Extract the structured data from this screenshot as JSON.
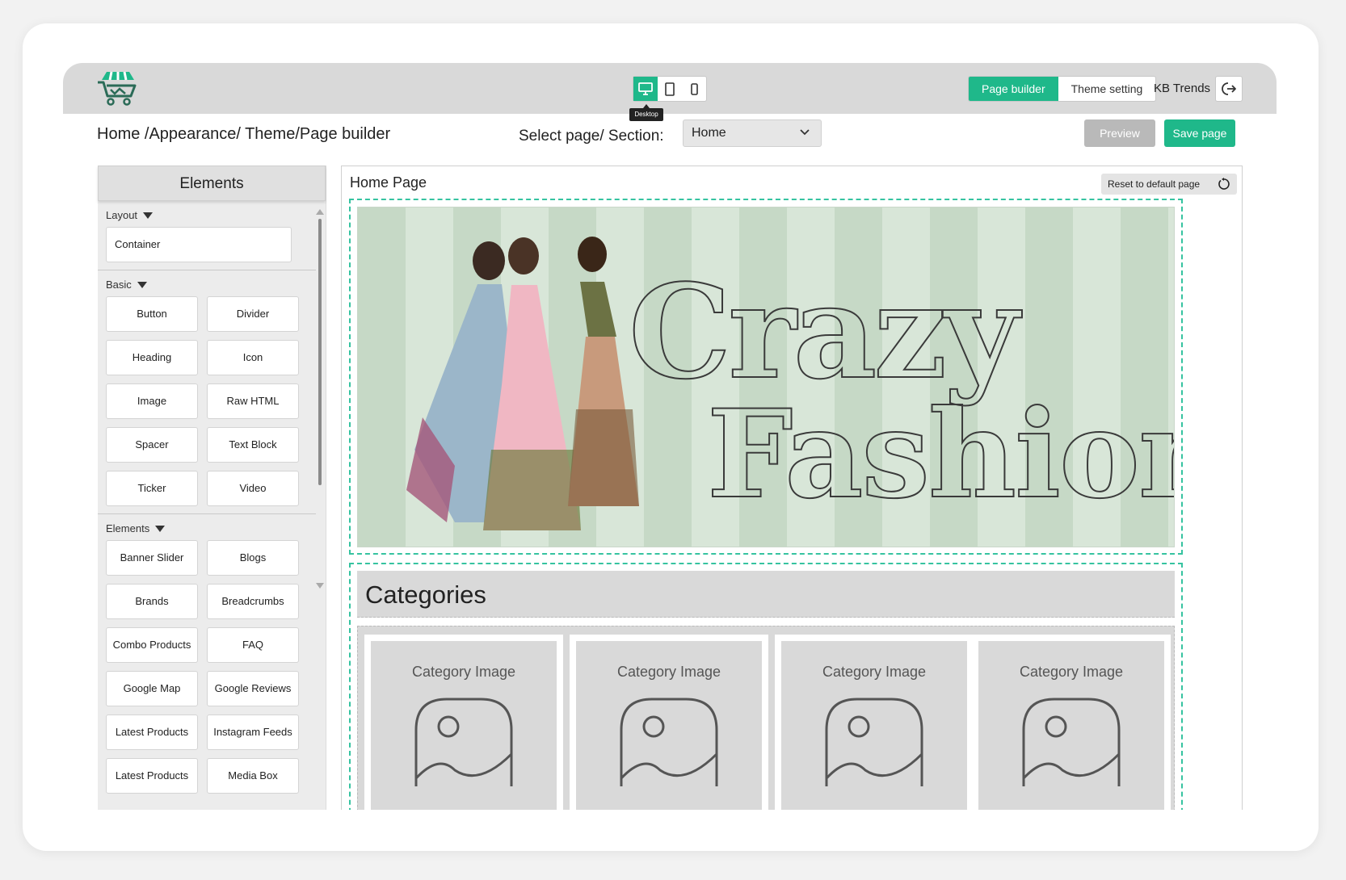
{
  "topbar": {
    "devices": [
      {
        "name": "desktop",
        "active": true
      },
      {
        "name": "tablet",
        "active": false
      },
      {
        "name": "mobile",
        "active": false
      }
    ],
    "tooltip": "Desktop",
    "modes": [
      "Page builder",
      "Theme setting"
    ],
    "active_mode": "Page builder",
    "user": "KB Trends"
  },
  "header": {
    "breadcrumb": "Home /Appearance/ Theme/Page builder",
    "select_label": "Select page/ Section:",
    "select_value": "Home",
    "preview_label": "Preview",
    "save_label": "Save page"
  },
  "sidebar": {
    "title": "Elements",
    "sections": [
      {
        "title": "Layout",
        "items": [
          "Container"
        ]
      },
      {
        "title": "Basic",
        "items": [
          "Button",
          "Divider",
          "Heading",
          "Icon",
          "Image",
          "Raw HTML",
          "Spacer",
          "Text Block",
          "Ticker",
          "Video"
        ]
      },
      {
        "title": "Elements",
        "items": [
          "Banner Slider",
          "Blogs",
          "Brands",
          "Breadcrumbs",
          "Combo Products",
          "FAQ",
          "Google Map",
          "Google Reviews",
          "Latest Products",
          "Instagram Feeds",
          "Latest Products",
          "Media Box"
        ]
      }
    ]
  },
  "canvas": {
    "title": "Home Page",
    "reset_label": "Reset to default page",
    "banner": {
      "line1": "Crazy",
      "line2": "Fashion"
    },
    "categories": {
      "heading": "Categories",
      "cards": [
        "Category Image",
        "Category Image",
        "Category Image",
        "Category Image"
      ]
    }
  },
  "colors": {
    "accent": "#1fb88a",
    "dashed": "#36c3a0",
    "topbar": "#d9d9d9"
  }
}
